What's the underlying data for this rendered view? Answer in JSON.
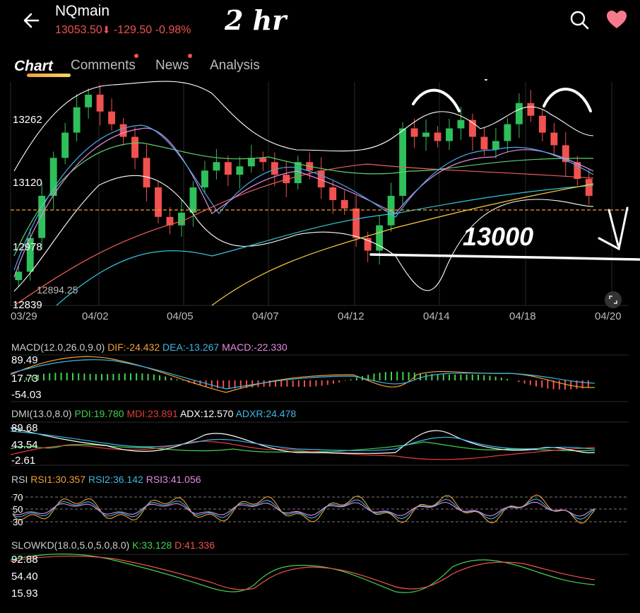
{
  "header": {
    "symbol": "NQmain",
    "price": "13053.50",
    "change": "-129.50",
    "change_pct": "-0.98%",
    "annotation": "2 hr",
    "back_icon": "arrow-left-icon",
    "search_icon": "search-icon",
    "favorite_icon": "heart-icon"
  },
  "colors": {
    "down": "#f0524f",
    "up": "#2fbf5b",
    "orange": "#f5a031",
    "blue": "#3fb6e6",
    "pink": "#e58be0",
    "green": "#43d14f",
    "white": "#ffffff",
    "red": "#e23b3b"
  },
  "tabs": [
    {
      "label": "Chart",
      "active": true,
      "badge": false
    },
    {
      "label": "Comments",
      "active": false,
      "badge": true
    },
    {
      "label": "News",
      "active": false,
      "badge": true
    },
    {
      "label": "Analysis",
      "active": false,
      "badge": false
    }
  ],
  "price_axis": [
    "13262",
    "13120",
    "12978",
    "12839"
  ],
  "low_marker": "12894.25",
  "dates": [
    "03/29",
    "04/02",
    "04/05",
    "04/07",
    "04/12",
    "04/14",
    "04/18",
    "04/20"
  ],
  "annotation_level": "13000",
  "indicators": {
    "macd": {
      "name": "MACD(12.0,26.0,9.0)",
      "dif": "DIF:-24.432",
      "dea": "DEA:-13.267",
      "macd": "MACD:-22.330",
      "axis": [
        "89.49",
        "17.73",
        "-54.03"
      ]
    },
    "dmi": {
      "name": "DMI(13.0,8.0)",
      "pdi": "PDI:19.780",
      "mdi": "MDI:23.891",
      "adx": "ADX:12.570",
      "adxr": "ADXR:24.478",
      "axis": [
        "89.68",
        "43.54",
        "-2.61"
      ]
    },
    "rsi": {
      "name": "RSI",
      "rsi1": "RSI1:30.357",
      "rsi2": "RSI2:36.142",
      "rsi3": "RSI3:41.056",
      "axis": [
        "70",
        "50",
        "30"
      ]
    },
    "slowkd": {
      "name": "SLOWKD(18.0,5.0,5.0,8.0)",
      "k": "K:33.128",
      "d": "D:41.336",
      "axis": [
        "92.88",
        "54.40",
        "15.93"
      ]
    }
  },
  "chart_data": {
    "type": "candlestick",
    "y_range": [
      12800,
      13330
    ],
    "price_levels": [
      13262,
      13120,
      12978,
      12839
    ],
    "dates": [
      "03/29",
      "04/02",
      "04/05",
      "04/07",
      "04/12",
      "04/14",
      "04/18",
      "04/20"
    ],
    "closes": [
      12880,
      12960,
      13060,
      13150,
      13210,
      13270,
      13300,
      13260,
      13230,
      13200,
      13150,
      13080,
      13010,
      12990,
      13020,
      13080,
      13120,
      13140,
      13110,
      13130,
      13150,
      13140,
      13110,
      13090,
      13140,
      13120,
      13080,
      13050,
      13030,
      12960,
      12930,
      12990,
      13060,
      13220,
      13200,
      13210,
      13190,
      13220,
      13240,
      13200,
      13170,
      13190,
      13230,
      13280,
      13250,
      13210,
      13180,
      13140,
      13100,
      13060
    ],
    "last_price": 13053.5,
    "low": 12894.25
  }
}
